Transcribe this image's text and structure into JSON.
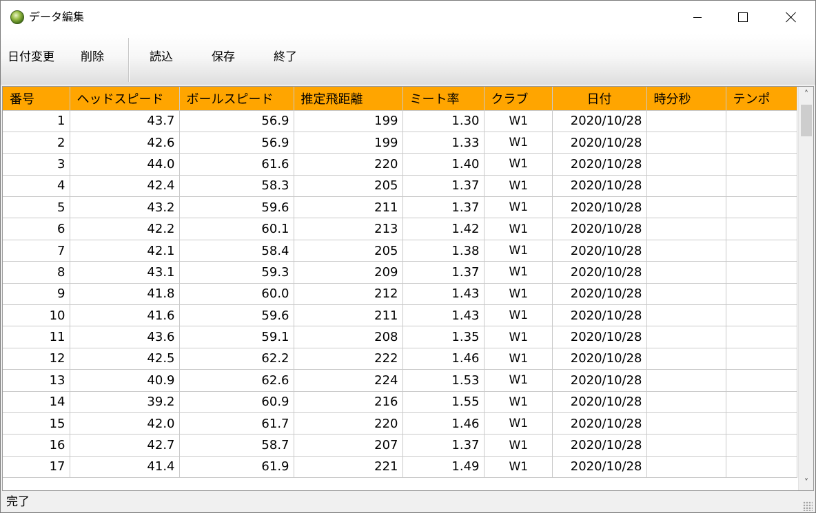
{
  "window": {
    "title": "データ編集"
  },
  "toolbar": {
    "buttons": [
      "日付変更",
      "削除",
      "読込",
      "保存",
      "終了"
    ]
  },
  "table": {
    "columns": [
      "番号",
      "ヘッドスピード",
      "ボールスピード",
      "推定飛距離",
      "ミート率",
      "クラブ",
      "日付",
      "時分秒",
      "テンポ"
    ],
    "rows": [
      [
        "1",
        "43.7",
        "56.9",
        "199",
        "1.30",
        "W1",
        "2020/10/28",
        "",
        ""
      ],
      [
        "2",
        "42.6",
        "56.9",
        "199",
        "1.33",
        "W1",
        "2020/10/28",
        "",
        ""
      ],
      [
        "3",
        "44.0",
        "61.6",
        "220",
        "1.40",
        "W1",
        "2020/10/28",
        "",
        ""
      ],
      [
        "4",
        "42.4",
        "58.3",
        "205",
        "1.37",
        "W1",
        "2020/10/28",
        "",
        ""
      ],
      [
        "5",
        "43.2",
        "59.6",
        "211",
        "1.37",
        "W1",
        "2020/10/28",
        "",
        ""
      ],
      [
        "6",
        "42.2",
        "60.1",
        "213",
        "1.42",
        "W1",
        "2020/10/28",
        "",
        ""
      ],
      [
        "7",
        "42.1",
        "58.4",
        "205",
        "1.38",
        "W1",
        "2020/10/28",
        "",
        ""
      ],
      [
        "8",
        "43.1",
        "59.3",
        "209",
        "1.37",
        "W1",
        "2020/10/28",
        "",
        ""
      ],
      [
        "9",
        "41.8",
        "60.0",
        "212",
        "1.43",
        "W1",
        "2020/10/28",
        "",
        ""
      ],
      [
        "10",
        "41.6",
        "59.6",
        "211",
        "1.43",
        "W1",
        "2020/10/28",
        "",
        ""
      ],
      [
        "11",
        "43.6",
        "59.1",
        "208",
        "1.35",
        "W1",
        "2020/10/28",
        "",
        ""
      ],
      [
        "12",
        "42.5",
        "62.2",
        "222",
        "1.46",
        "W1",
        "2020/10/28",
        "",
        ""
      ],
      [
        "13",
        "40.9",
        "62.6",
        "224",
        "1.53",
        "W1",
        "2020/10/28",
        "",
        ""
      ],
      [
        "14",
        "39.2",
        "60.9",
        "216",
        "1.55",
        "W1",
        "2020/10/28",
        "",
        ""
      ],
      [
        "15",
        "42.0",
        "61.7",
        "220",
        "1.46",
        "W1",
        "2020/10/28",
        "",
        ""
      ],
      [
        "16",
        "42.7",
        "58.7",
        "207",
        "1.37",
        "W1",
        "2020/10/28",
        "",
        ""
      ],
      [
        "17",
        "41.4",
        "61.9",
        "221",
        "1.49",
        "W1",
        "2020/10/28",
        "",
        ""
      ]
    ]
  },
  "status": {
    "text": "完了"
  },
  "colors": {
    "header": "#ffa500",
    "gridline": "#c9c9c9"
  }
}
